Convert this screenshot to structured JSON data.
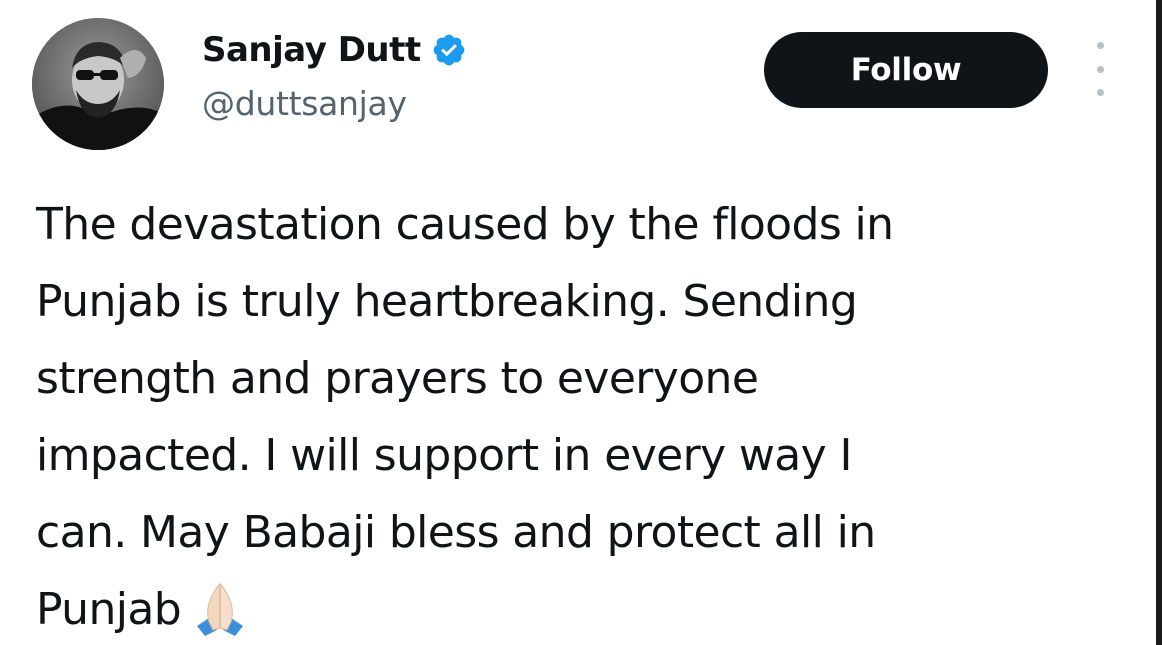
{
  "author": {
    "display_name": "Sanjay Dutt",
    "handle": "@duttsanjay",
    "verified": true,
    "avatar_icon": "profile-photo"
  },
  "actions": {
    "follow_label": "Follow",
    "more_icon": "more-options-icon"
  },
  "tweet": {
    "lines": [
      "The devastation caused by the floods in",
      "Punjab is truly heartbreaking. Sending",
      "strength and prayers to everyone",
      "impacted. I will support in every way I",
      "can. May Babaji bless and protect all in",
      "Punjab"
    ],
    "trailing_emoji": "folded-hands-emoji"
  },
  "colors": {
    "text": "#0f1419",
    "handle": "#536471",
    "verified_badge": "#1d9bf0",
    "follow_bg": "#0f1419",
    "follow_text": "#ffffff"
  }
}
